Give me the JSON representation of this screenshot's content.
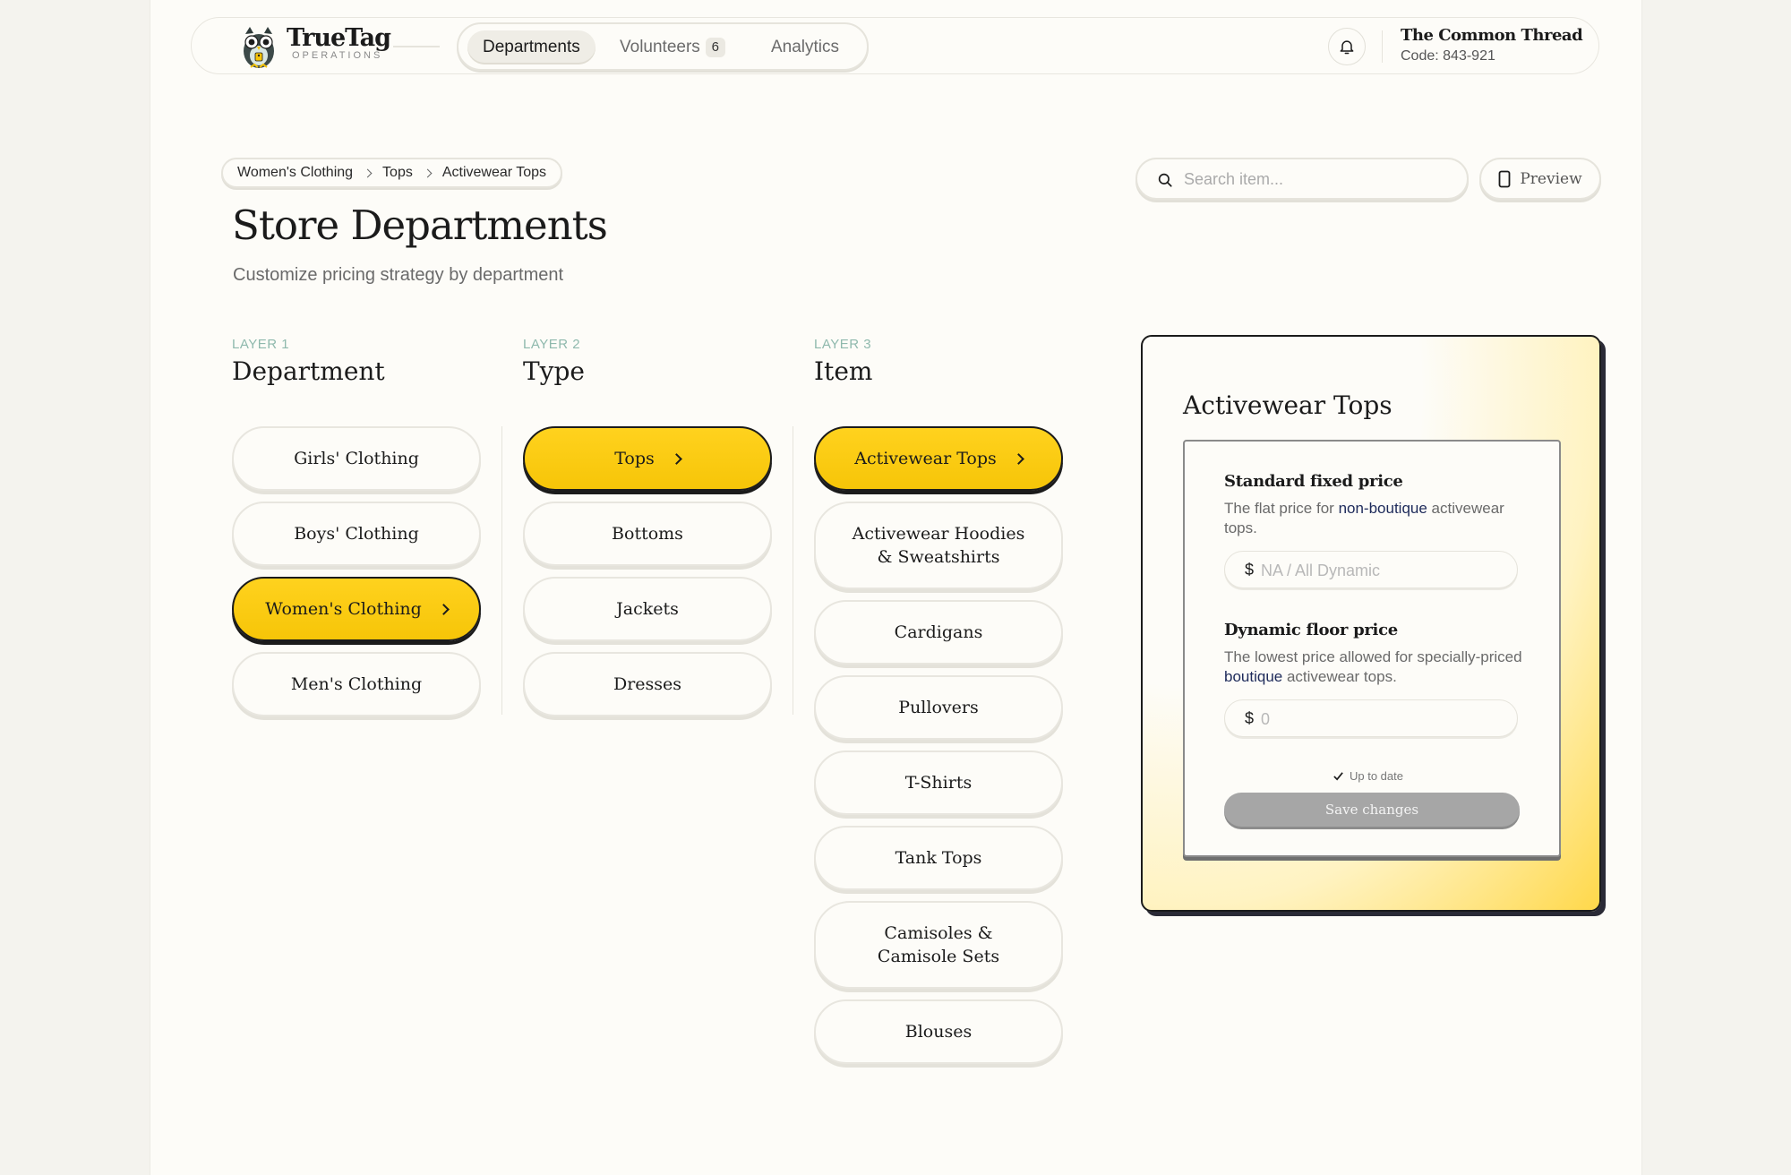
{
  "brand": {
    "name": "TrueTag",
    "sub": "OPERATIONS"
  },
  "nav": {
    "departments": "Departments",
    "volunteers": "Volunteers",
    "volunteers_count": "6",
    "analytics": "Analytics"
  },
  "store": {
    "name": "The Common Thread",
    "code": "Code: 843-921"
  },
  "breadcrumb": [
    "Women's Clothing",
    "Tops",
    "Activewear Tops"
  ],
  "page": {
    "title": "Store Departments",
    "subtitle": "Customize pricing strategy by department"
  },
  "search": {
    "placeholder": "Search item..."
  },
  "preview_label": "Preview",
  "layers": [
    {
      "label": "LAYER 1",
      "title": "Department",
      "items": [
        "Girls' Clothing",
        "Boys' Clothing",
        "Women's Clothing",
        "Men's Clothing"
      ],
      "active": 2
    },
    {
      "label": "LAYER 2",
      "title": "Type",
      "items": [
        "Tops",
        "Bottoms",
        "Jackets",
        "Dresses"
      ],
      "active": 0
    },
    {
      "label": "LAYER 3",
      "title": "Item",
      "items": [
        "Activewear Tops",
        "Activewear Hoodies & Sweatshirts",
        "Cardigans",
        "Pullovers",
        "T-Shirts",
        "Tank Tops",
        "Camisoles & Camisole Sets",
        "Blouses"
      ],
      "active": 0
    }
  ],
  "detail": {
    "title": "Activewear Tops",
    "fixed": {
      "title": "Standard fixed price",
      "desc_pre": "The flat price for ",
      "desc_hl": "non-boutique",
      "desc_post": " activewear tops.",
      "currency": "$",
      "placeholder": "NA / All Dynamic"
    },
    "floor": {
      "title": "Dynamic floor price",
      "desc_pre": "The lowest price allowed for specially-priced ",
      "desc_hl": "boutique",
      "desc_post": " activewear tops.",
      "currency": "$",
      "placeholder": "0"
    },
    "status": "Up to date",
    "save_label": "Save changes"
  },
  "colors": {
    "accent": "#FFD21E",
    "ink": "#1B1B1B",
    "layer_label": "#8FB9AD",
    "highlight": "#1D2A5A"
  }
}
